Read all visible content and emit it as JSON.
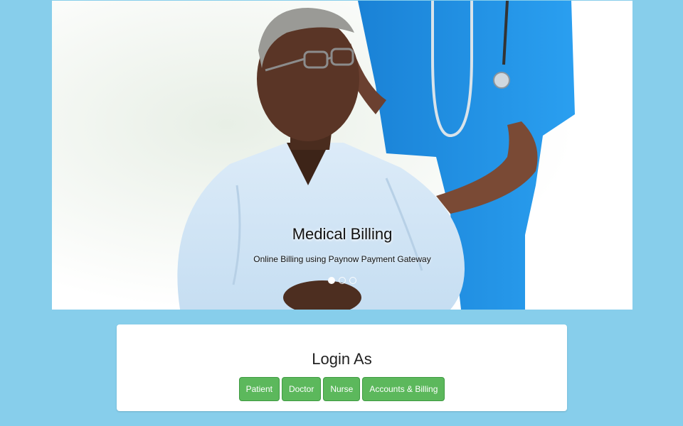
{
  "carousel": {
    "title": "Medical Billing",
    "subtitle": "Online Billing using Paynow Payment Gateway",
    "slide_count": 3,
    "active_slide": 1
  },
  "login": {
    "heading": "Login As",
    "buttons": [
      "Patient",
      "Doctor",
      "Nurse",
      "Accounts & Billing"
    ]
  },
  "colors": {
    "page_bg": "#87ceeb",
    "button_green": "#5cb85c",
    "scrubs_blue": "#1e8fe0",
    "shirt_light_blue": "#cfe6f7"
  }
}
